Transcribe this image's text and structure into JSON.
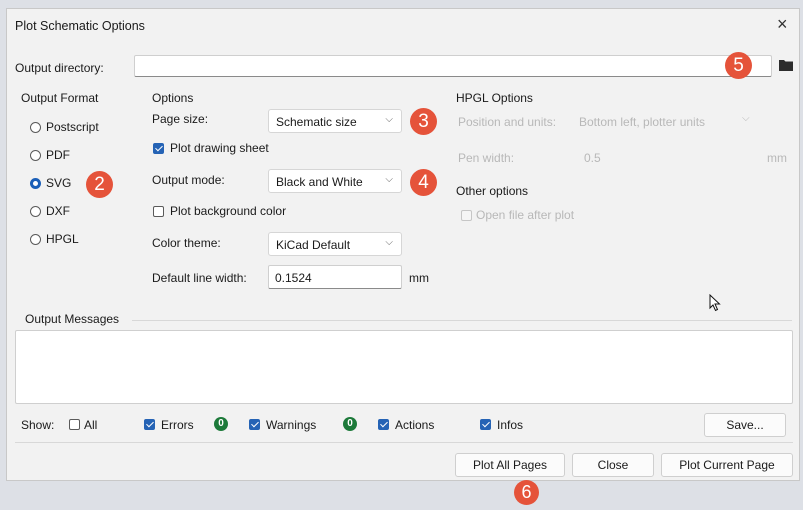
{
  "window": {
    "title": "Plot Schematic Options",
    "close_glyph": "×"
  },
  "output_directory": {
    "label": "Output directory:",
    "value": "",
    "folder_icon": "folder-icon"
  },
  "output_format": {
    "heading": "Output Format",
    "options": [
      "Postscript",
      "PDF",
      "SVG",
      "DXF",
      "HPGL"
    ],
    "selected": "SVG"
  },
  "options": {
    "heading": "Options",
    "page_size_label": "Page size:",
    "page_size_value": "Schematic size",
    "plot_drawing_sheet_label": "Plot drawing sheet",
    "plot_drawing_sheet_checked": true,
    "output_mode_label": "Output mode:",
    "output_mode_value": "Black and White",
    "plot_background_label": "Plot background color",
    "plot_background_checked": false,
    "color_theme_label": "Color theme:",
    "color_theme_value": "KiCad Default",
    "line_width_label": "Default line width:",
    "line_width_value": "0.1524",
    "line_width_unit": "mm"
  },
  "hpgl": {
    "heading": "HPGL Options",
    "position_label": "Position and units:",
    "position_value": "Bottom left, plotter units",
    "pen_width_label": "Pen width:",
    "pen_width_value": "0.5",
    "pen_width_unit": "mm"
  },
  "other": {
    "heading": "Other options",
    "open_file_label": "Open file after plot"
  },
  "messages": {
    "heading": "Output Messages",
    "text": ""
  },
  "filters": {
    "show_label": "Show:",
    "all_label": "All",
    "errors_label": "Errors",
    "errors_count": "0",
    "warnings_label": "Warnings",
    "warnings_count": "0",
    "actions_label": "Actions",
    "infos_label": "Infos",
    "save_label": "Save..."
  },
  "buttons": {
    "plot_all": "Plot All Pages",
    "close": "Close",
    "plot_current": "Plot Current Page"
  },
  "markers": {
    "m2": "2",
    "m3": "3",
    "m4": "4",
    "m5": "5",
    "m6": "6"
  },
  "colors": {
    "accent": "#2563b5",
    "marker": "#e5533a",
    "badge": "#1d7a3a"
  }
}
